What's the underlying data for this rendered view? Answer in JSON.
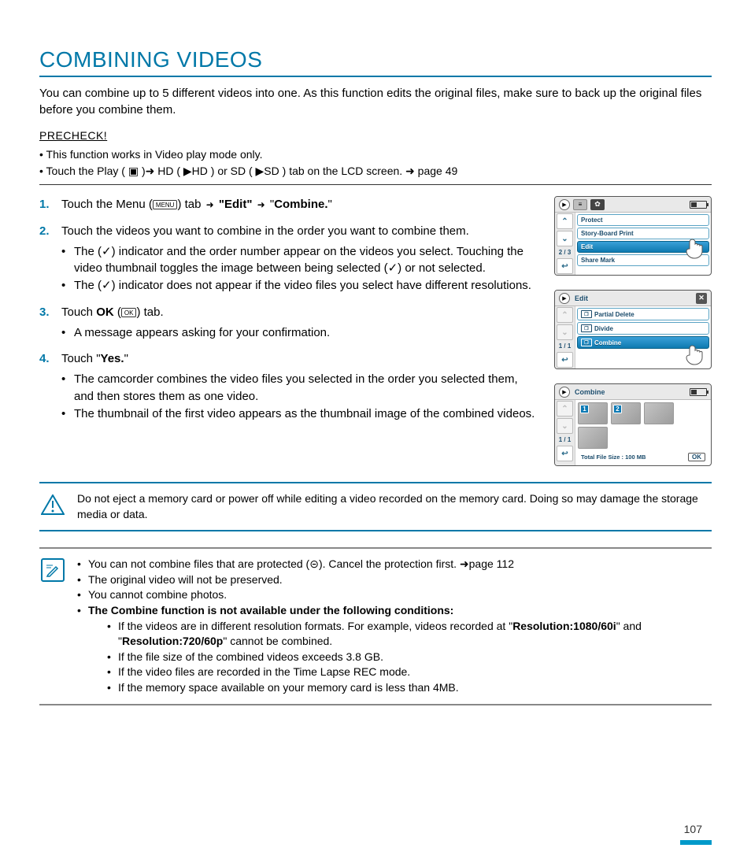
{
  "title": "COMBINING VIDEOS",
  "intro": "You can combine up to 5 different videos into one. As this function edits the original files, make sure to back up the original files before you combine them.",
  "precheck": {
    "heading": "PRECHECK!",
    "items": [
      "This function works in Video play mode only.",
      "Touch the Play ( ▣ )➜ HD ( ▶HD ) or SD ( ▶SD ) tab on the LCD screen. ➜ page 49"
    ]
  },
  "steps": {
    "s1_a": "Touch the Menu (",
    "s1_menu": "MENU",
    "s1_b": ") tab ",
    "s1_edit": "\"Edit\"",
    "s1_combine": "Combine.",
    "s2": "Touch the videos you want to combine in the order you want to combine them.",
    "s2_b1": "The (✓) indicator and the order number appear on the videos you select. Touching the video thumbnail toggles the image between being selected (✓) or not selected.",
    "s2_b2": "The (✓) indicator does not appear if the video files you select have different resolutions.",
    "s3_a": "Touch ",
    "s3_ok": "OK",
    "s3_b": " (",
    "s3_okicon": "OK",
    "s3_c": ") tab.",
    "s3_sub": "A message appears asking for your confirmation.",
    "s4_a": "Touch \"",
    "s4_yes": "Yes.",
    "s4_b": "\"",
    "s4_sub1": "The camcorder combines the video files you selected in the order you selected them, and then stores them as one video.",
    "s4_sub2": "The thumbnail of the first video appears as the thumbnail image of the combined videos."
  },
  "panel1": {
    "page": "2 / 3",
    "items": [
      "Protect",
      "Story-Board Print",
      "Edit",
      "Share Mark"
    ],
    "selected": 2
  },
  "panel2": {
    "title": "Edit",
    "page": "1 / 1",
    "items": [
      "Partial Delete",
      "Divide",
      "Combine"
    ],
    "selected": 2
  },
  "panel3": {
    "title": "Combine",
    "page": "1 / 1",
    "thumb1": "1",
    "thumb2": "2",
    "footer": "Total File Size : 100 MB",
    "ok": "OK"
  },
  "warning": "Do not eject a memory card or power off while editing a video recorded on the memory card. Doing so may damage the storage media or data.",
  "tips": {
    "b1": "You can not combine files that are protected (⊝). Cancel the protection first. ➜page 112",
    "b2": "The original video will not be preserved.",
    "b3": "You cannot combine photos.",
    "b4": "The Combine function is not available under the following conditions:",
    "d1_a": "If the videos are in different resolution formats. For example, videos recorded at \"",
    "d1_r1": "Resolution:1080/60i",
    "d1_mid": "\" and \"",
    "d1_r2": "Resolution:720/60p",
    "d1_b": "\" cannot be combined.",
    "d2": "If the file size of the combined videos exceeds 3.8 GB.",
    "d3": "If the video files are recorded in the Time Lapse REC mode.",
    "d4": "If the memory space available on your memory card is less than 4MB."
  },
  "page_number": "107"
}
